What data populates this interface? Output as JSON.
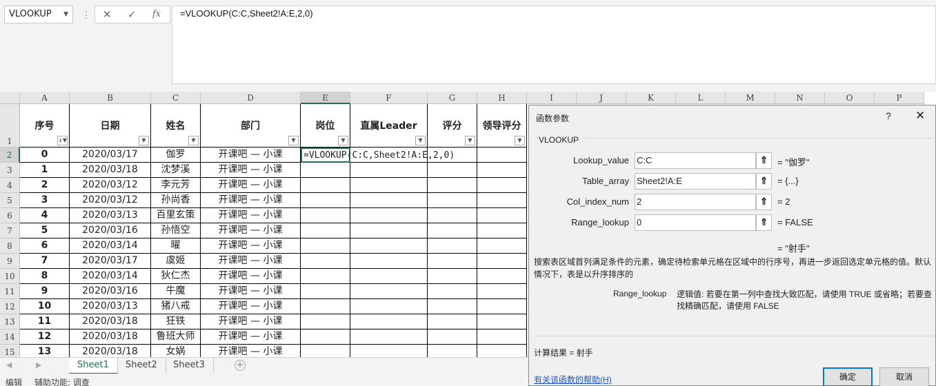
{
  "formula_bar": {
    "name_box": "VLOOKUP",
    "separator": "⋮",
    "cancel_glyph": "✕",
    "enter_glyph": "✓",
    "fx_glyph": "fx",
    "formula": "=VLOOKUP(C:C,Sheet2!A:E,2,0)"
  },
  "grid": {
    "columns": [
      "A",
      "B",
      "C",
      "D",
      "E",
      "F",
      "G",
      "H",
      "I",
      "J",
      "K",
      "L",
      "M",
      "N",
      "O",
      "P"
    ],
    "row_numbers": [
      "1",
      "2",
      "3",
      "4",
      "5",
      "6",
      "7",
      "8",
      "9",
      "10",
      "11",
      "12",
      "13",
      "14",
      "15"
    ],
    "headers": [
      "序号",
      "日期",
      "姓名",
      "部门",
      "岗位",
      "直属Leader",
      "评分",
      "领导评分"
    ],
    "filter_glyph": "▼",
    "sorted_filter_glyph": "↓▼",
    "rows": [
      {
        "id": "0",
        "date": "2020/03/17",
        "name": "伽罗",
        "dept": "开课吧 — 小课"
      },
      {
        "id": "1",
        "date": "2020/03/18",
        "name": "沈梦溪",
        "dept": "开课吧 — 小课"
      },
      {
        "id": "2",
        "date": "2020/03/12",
        "name": "李元芳",
        "dept": "开课吧 — 小课"
      },
      {
        "id": "3",
        "date": "2020/03/12",
        "name": "孙尚香",
        "dept": "开课吧 — 小课"
      },
      {
        "id": "4",
        "date": "2020/03/13",
        "name": "百里玄策",
        "dept": "开课吧 — 小课"
      },
      {
        "id": "5",
        "date": "2020/03/16",
        "name": "孙悟空",
        "dept": "开课吧 — 小课"
      },
      {
        "id": "6",
        "date": "2020/03/14",
        "name": "曜",
        "dept": "开课吧 — 小课"
      },
      {
        "id": "7",
        "date": "2020/03/17",
        "name": "虞姬",
        "dept": "开课吧 — 小课"
      },
      {
        "id": "8",
        "date": "2020/03/14",
        "name": "狄仁杰",
        "dept": "开课吧 — 小课"
      },
      {
        "id": "9",
        "date": "2020/03/16",
        "name": "牛魔",
        "dept": "开课吧 — 小课"
      },
      {
        "id": "10",
        "date": "2020/03/13",
        "name": "猪八戒",
        "dept": "开课吧 — 小课"
      },
      {
        "id": "11",
        "date": "2020/03/18",
        "name": "狂铁",
        "dept": "开课吧 — 小课"
      },
      {
        "id": "12",
        "date": "2020/03/18",
        "name": "鲁班大师",
        "dept": "开课吧 — 小课"
      },
      {
        "id": "13",
        "date": "2020/03/18",
        "name": "女娲",
        "dept": "开课吧 — 小课"
      }
    ],
    "editing_formula": "=VLOOKUP(C:C,Sheet2!A:E,2,0)"
  },
  "tabs": {
    "prev_glyph": "◀",
    "next_glyph": "▶",
    "sheets": [
      "Sheet1",
      "Sheet2",
      "Sheet3"
    ],
    "active": "Sheet1",
    "add_glyph": "+"
  },
  "status": {
    "mode": "编辑",
    "accessibility": "辅助功能: 调查"
  },
  "dialog": {
    "title": "函数参数",
    "help_glyph": "?",
    "close_glyph": "✕",
    "function_name": "VLOOKUP",
    "args": [
      {
        "label": "Lookup_value",
        "value": "C:C",
        "result": "= \"伽罗\""
      },
      {
        "label": "Table_array",
        "value": "Sheet2!A:E",
        "result": "= {...}"
      },
      {
        "label": "Col_index_num",
        "value": "2",
        "result": "= 2"
      },
      {
        "label": "Range_lookup",
        "value": "0",
        "result": "= FALSE"
      }
    ],
    "collapse_glyph": "⇑",
    "formula_result": "= \"射手\"",
    "description": "搜索表区域首列满足条件的元素，确定待检索单元格在区域中的行序号，再进一步返回选定单元格的值。默认情况下，表是以升序排序的",
    "arg_label": "Range_lookup",
    "arg_description": "逻辑值: 若要在第一列中查找大致匹配，请使用 TRUE 或省略；若要查找精确匹配，请使用 FALSE",
    "calc_result": "计算结果 =   射手",
    "help_link": "有关该函数的帮助(H)",
    "ok": "确定",
    "cancel": "取消"
  }
}
